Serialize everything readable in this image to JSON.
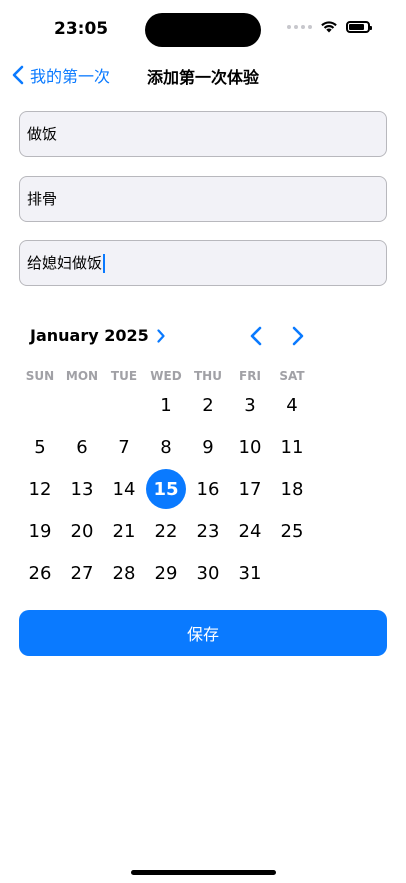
{
  "status_bar": {
    "time": "23:05"
  },
  "nav": {
    "back_label": "我的第一次",
    "title": "添加第一次体验"
  },
  "form": {
    "field1": "做饭",
    "field2": "排骨",
    "field3": "给媳妇做饭"
  },
  "calendar": {
    "month_label": "January 2025",
    "weekdays": [
      "SUN",
      "MON",
      "TUE",
      "WED",
      "THU",
      "FRI",
      "SAT"
    ],
    "leading_blanks": 3,
    "days": [
      "1",
      "2",
      "3",
      "4",
      "5",
      "6",
      "7",
      "8",
      "9",
      "10",
      "11",
      "12",
      "13",
      "14",
      "15",
      "16",
      "17",
      "18",
      "19",
      "20",
      "21",
      "22",
      "23",
      "24",
      "25",
      "26",
      "27",
      "28",
      "29",
      "30",
      "31"
    ],
    "selected_day": "15"
  },
  "save_label": "保存",
  "colors": {
    "accent": "#0a7aff",
    "field_bg": "#f2f2f7"
  }
}
